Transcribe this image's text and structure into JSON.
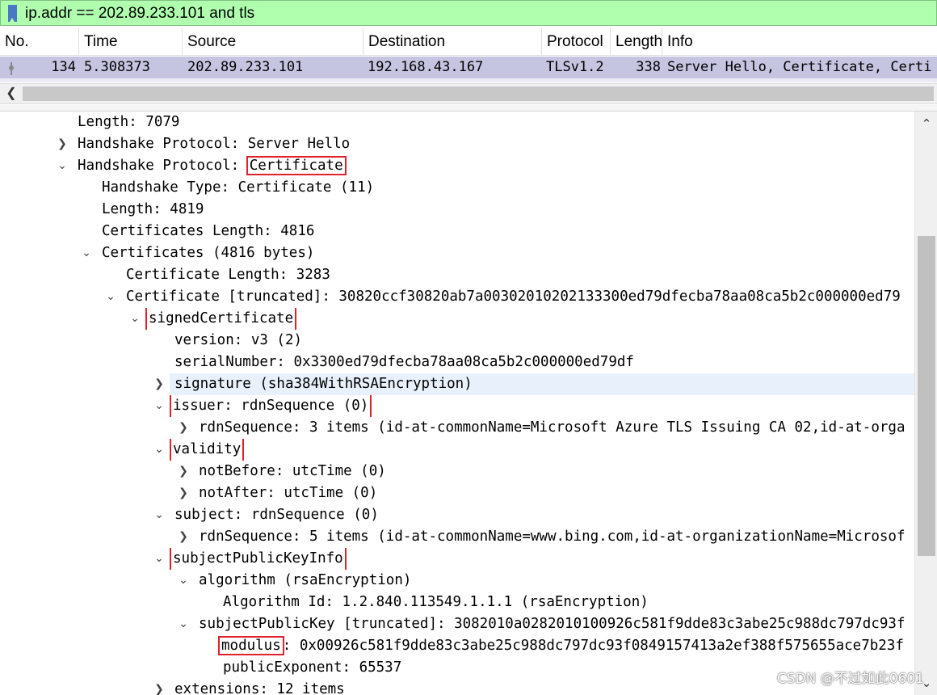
{
  "filter": {
    "value": "ip.addr == 202.89.233.101 and tls"
  },
  "packet_list": {
    "columns": [
      "No.",
      "Time",
      "Source",
      "Destination",
      "Protocol",
      "Length",
      "Info"
    ],
    "row": {
      "no": "134",
      "time": "5.308373",
      "source": "202.89.233.101",
      "destination": "192.168.43.167",
      "protocol": "TLSv1.2",
      "length": "338",
      "info": "Server Hello, Certificate, Certi"
    }
  },
  "details": [
    {
      "text": "Length: 7079"
    },
    {
      "prefix": "Handshake Protocol: ",
      "text": "Server Hello"
    },
    {
      "prefix": "Handshake Protocol: ",
      "text": "Certificate"
    },
    {
      "text": "Handshake Type: Certificate (11)"
    },
    {
      "text": "Length: 4819"
    },
    {
      "text": "Certificates Length: 4816"
    },
    {
      "text": "Certificates (4816 bytes)"
    },
    {
      "text": "Certificate Length: 3283"
    },
    {
      "text": "Certificate [truncated]: 30820ccf30820ab7a00302010202133300ed79dfecba78aa08ca5b2c000000ed79"
    },
    {
      "text": "signedCertificate"
    },
    {
      "text": "version: v3 (2)"
    },
    {
      "text": "serialNumber: 0x3300ed79dfecba78aa08ca5b2c000000ed79df"
    },
    {
      "text": "signature (sha384WithRSAEncryption)"
    },
    {
      "text": "issuer: rdnSequence (0)"
    },
    {
      "text": "rdnSequence: 3 items (id-at-commonName=Microsoft Azure TLS Issuing CA 02,id-at-orga"
    },
    {
      "text": "validity"
    },
    {
      "text": "notBefore: utcTime (0)"
    },
    {
      "text": "notAfter: utcTime (0)"
    },
    {
      "text": "subject: rdnSequence (0)"
    },
    {
      "text": "rdnSequence: 5 items (id-at-commonName=www.bing.com,id-at-organizationName=Microsof"
    },
    {
      "text": "subjectPublicKeyInfo"
    },
    {
      "text": "algorithm (rsaEncryption)"
    },
    {
      "text": "Algorithm Id: 1.2.840.113549.1.1.1 (rsaEncryption)"
    },
    {
      "text": "subjectPublicKey [truncated]: 3082010a0282010100926c581f9dde83c3abe25c988dc797dc93f"
    },
    {
      "label": "modulus",
      "text": ": 0x00926c581f9dde83c3abe25c988dc797dc93f0849157413a2ef388f575655ace7b23f"
    },
    {
      "text": "publicExponent: 65537"
    },
    {
      "text": "extensions: 12 items"
    }
  ],
  "watermark": "CSDN @不过如此0601",
  "colors": {
    "filter_bg": "#afffaf",
    "selected_row": "#c5c5e2",
    "annotation_box": "#e0212b",
    "hover_row": "#e8f1fb"
  },
  "icons": {
    "filter": "bookmark-icon",
    "expanded": "chevron-down-icon",
    "collapsed": "chevron-right-icon"
  }
}
